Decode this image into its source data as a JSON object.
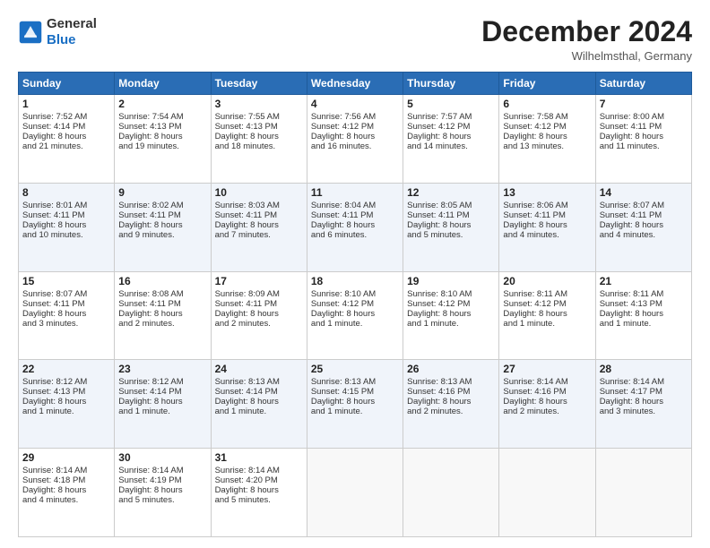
{
  "header": {
    "logo_line1": "General",
    "logo_line2": "Blue",
    "month": "December 2024",
    "location": "Wilhelmsthal, Germany"
  },
  "days_of_week": [
    "Sunday",
    "Monday",
    "Tuesday",
    "Wednesday",
    "Thursday",
    "Friday",
    "Saturday"
  ],
  "weeks": [
    [
      {
        "day": "1",
        "lines": [
          "Sunrise: 7:52 AM",
          "Sunset: 4:14 PM",
          "Daylight: 8 hours",
          "and 21 minutes."
        ]
      },
      {
        "day": "2",
        "lines": [
          "Sunrise: 7:54 AM",
          "Sunset: 4:13 PM",
          "Daylight: 8 hours",
          "and 19 minutes."
        ]
      },
      {
        "day": "3",
        "lines": [
          "Sunrise: 7:55 AM",
          "Sunset: 4:13 PM",
          "Daylight: 8 hours",
          "and 18 minutes."
        ]
      },
      {
        "day": "4",
        "lines": [
          "Sunrise: 7:56 AM",
          "Sunset: 4:12 PM",
          "Daylight: 8 hours",
          "and 16 minutes."
        ]
      },
      {
        "day": "5",
        "lines": [
          "Sunrise: 7:57 AM",
          "Sunset: 4:12 PM",
          "Daylight: 8 hours",
          "and 14 minutes."
        ]
      },
      {
        "day": "6",
        "lines": [
          "Sunrise: 7:58 AM",
          "Sunset: 4:12 PM",
          "Daylight: 8 hours",
          "and 13 minutes."
        ]
      },
      {
        "day": "7",
        "lines": [
          "Sunrise: 8:00 AM",
          "Sunset: 4:11 PM",
          "Daylight: 8 hours",
          "and 11 minutes."
        ]
      }
    ],
    [
      {
        "day": "8",
        "lines": [
          "Sunrise: 8:01 AM",
          "Sunset: 4:11 PM",
          "Daylight: 8 hours",
          "and 10 minutes."
        ]
      },
      {
        "day": "9",
        "lines": [
          "Sunrise: 8:02 AM",
          "Sunset: 4:11 PM",
          "Daylight: 8 hours",
          "and 9 minutes."
        ]
      },
      {
        "day": "10",
        "lines": [
          "Sunrise: 8:03 AM",
          "Sunset: 4:11 PM",
          "Daylight: 8 hours",
          "and 7 minutes."
        ]
      },
      {
        "day": "11",
        "lines": [
          "Sunrise: 8:04 AM",
          "Sunset: 4:11 PM",
          "Daylight: 8 hours",
          "and 6 minutes."
        ]
      },
      {
        "day": "12",
        "lines": [
          "Sunrise: 8:05 AM",
          "Sunset: 4:11 PM",
          "Daylight: 8 hours",
          "and 5 minutes."
        ]
      },
      {
        "day": "13",
        "lines": [
          "Sunrise: 8:06 AM",
          "Sunset: 4:11 PM",
          "Daylight: 8 hours",
          "and 4 minutes."
        ]
      },
      {
        "day": "14",
        "lines": [
          "Sunrise: 8:07 AM",
          "Sunset: 4:11 PM",
          "Daylight: 8 hours",
          "and 4 minutes."
        ]
      }
    ],
    [
      {
        "day": "15",
        "lines": [
          "Sunrise: 8:07 AM",
          "Sunset: 4:11 PM",
          "Daylight: 8 hours",
          "and 3 minutes."
        ]
      },
      {
        "day": "16",
        "lines": [
          "Sunrise: 8:08 AM",
          "Sunset: 4:11 PM",
          "Daylight: 8 hours",
          "and 2 minutes."
        ]
      },
      {
        "day": "17",
        "lines": [
          "Sunrise: 8:09 AM",
          "Sunset: 4:11 PM",
          "Daylight: 8 hours",
          "and 2 minutes."
        ]
      },
      {
        "day": "18",
        "lines": [
          "Sunrise: 8:10 AM",
          "Sunset: 4:12 PM",
          "Daylight: 8 hours",
          "and 1 minute."
        ]
      },
      {
        "day": "19",
        "lines": [
          "Sunrise: 8:10 AM",
          "Sunset: 4:12 PM",
          "Daylight: 8 hours",
          "and 1 minute."
        ]
      },
      {
        "day": "20",
        "lines": [
          "Sunrise: 8:11 AM",
          "Sunset: 4:12 PM",
          "Daylight: 8 hours",
          "and 1 minute."
        ]
      },
      {
        "day": "21",
        "lines": [
          "Sunrise: 8:11 AM",
          "Sunset: 4:13 PM",
          "Daylight: 8 hours",
          "and 1 minute."
        ]
      }
    ],
    [
      {
        "day": "22",
        "lines": [
          "Sunrise: 8:12 AM",
          "Sunset: 4:13 PM",
          "Daylight: 8 hours",
          "and 1 minute."
        ]
      },
      {
        "day": "23",
        "lines": [
          "Sunrise: 8:12 AM",
          "Sunset: 4:14 PM",
          "Daylight: 8 hours",
          "and 1 minute."
        ]
      },
      {
        "day": "24",
        "lines": [
          "Sunrise: 8:13 AM",
          "Sunset: 4:14 PM",
          "Daylight: 8 hours",
          "and 1 minute."
        ]
      },
      {
        "day": "25",
        "lines": [
          "Sunrise: 8:13 AM",
          "Sunset: 4:15 PM",
          "Daylight: 8 hours",
          "and 1 minute."
        ]
      },
      {
        "day": "26",
        "lines": [
          "Sunrise: 8:13 AM",
          "Sunset: 4:16 PM",
          "Daylight: 8 hours",
          "and 2 minutes."
        ]
      },
      {
        "day": "27",
        "lines": [
          "Sunrise: 8:14 AM",
          "Sunset: 4:16 PM",
          "Daylight: 8 hours",
          "and 2 minutes."
        ]
      },
      {
        "day": "28",
        "lines": [
          "Sunrise: 8:14 AM",
          "Sunset: 4:17 PM",
          "Daylight: 8 hours",
          "and 3 minutes."
        ]
      }
    ],
    [
      {
        "day": "29",
        "lines": [
          "Sunrise: 8:14 AM",
          "Sunset: 4:18 PM",
          "Daylight: 8 hours",
          "and 4 minutes."
        ]
      },
      {
        "day": "30",
        "lines": [
          "Sunrise: 8:14 AM",
          "Sunset: 4:19 PM",
          "Daylight: 8 hours",
          "and 5 minutes."
        ]
      },
      {
        "day": "31",
        "lines": [
          "Sunrise: 8:14 AM",
          "Sunset: 4:20 PM",
          "Daylight: 8 hours",
          "and 5 minutes."
        ]
      },
      null,
      null,
      null,
      null
    ]
  ]
}
